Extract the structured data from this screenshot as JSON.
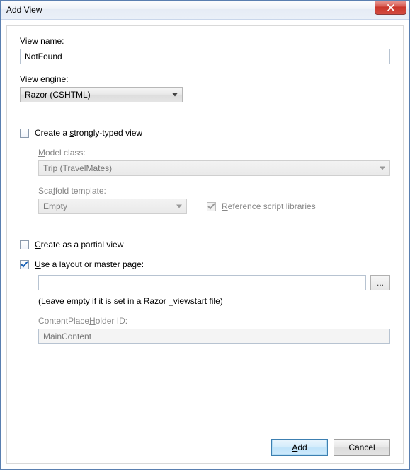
{
  "window": {
    "title": "Add View"
  },
  "labels": {
    "view_name_pre": "View ",
    "view_name_u": "n",
    "view_name_post": "ame:",
    "view_engine_pre": "View ",
    "view_engine_u": "e",
    "view_engine_post": "ngine:",
    "strong_pre": "Create a ",
    "strong_u": "s",
    "strong_post": "trongly-typed view",
    "model_u": "M",
    "model_post": "odel class:",
    "scaffold_pre": "Sca",
    "scaffold_u": "f",
    "scaffold_post": "fold template:",
    "reflib_u": "R",
    "reflib_post": "eference script libraries",
    "partial_u": "C",
    "partial_post": "reate as a partial view",
    "layout_u": "U",
    "layout_post": "se a layout or master page:",
    "layout_hint": "(Leave empty if it is set in a Razor _viewstart file)",
    "cph_pre": "ContentPlace",
    "cph_u": "H",
    "cph_post": "older ID:"
  },
  "values": {
    "view_name": "NotFound",
    "view_engine": "Razor (CSHTML)",
    "model_class": "Trip (TravelMates)",
    "scaffold": "Empty",
    "layout_path": "",
    "cph_id": "MainContent"
  },
  "checks": {
    "strongly_typed": false,
    "reference_libs": true,
    "partial": false,
    "use_layout": true
  },
  "buttons": {
    "browse": "...",
    "add_u": "A",
    "add_post": "dd",
    "cancel": "Cancel"
  }
}
